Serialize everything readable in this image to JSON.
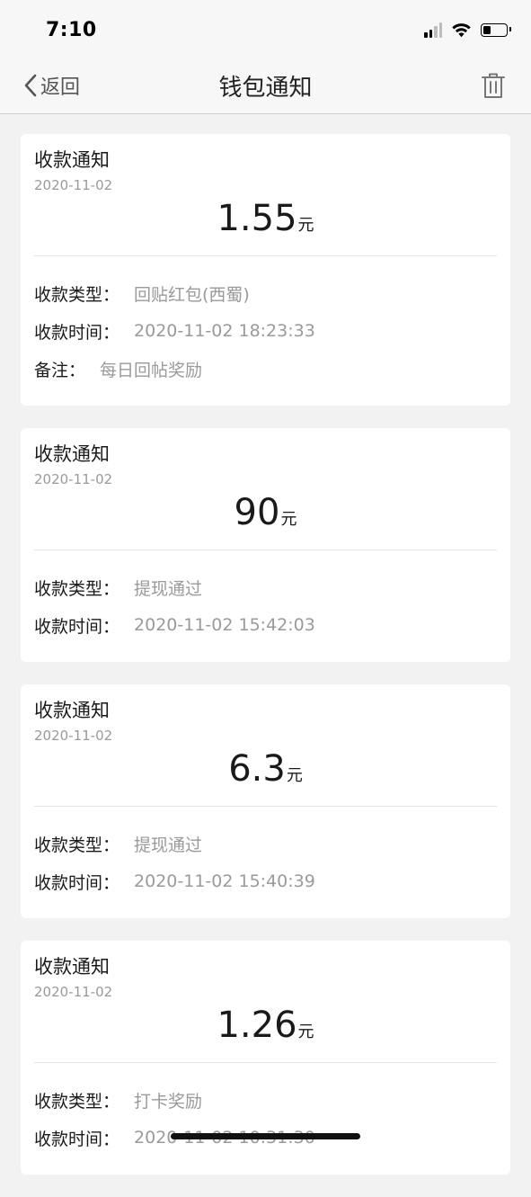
{
  "status_bar": {
    "time": "7:10"
  },
  "nav": {
    "back_label": "返回",
    "title": "钱包通知"
  },
  "notifications": [
    {
      "title": "收款通知",
      "date": "2020-11-02",
      "amount": "1.55",
      "unit": "元",
      "rows": [
        {
          "label": "收款类型：",
          "value": "回贴红包(西蜀)"
        },
        {
          "label": "收款时间：",
          "value": "2020-11-02 18:23:33"
        },
        {
          "label": "备注：",
          "value": "每日回帖奖励"
        }
      ]
    },
    {
      "title": "收款通知",
      "date": "2020-11-02",
      "amount": "90",
      "unit": "元",
      "rows": [
        {
          "label": "收款类型：",
          "value": "提现通过"
        },
        {
          "label": "收款时间：",
          "value": "2020-11-02 15:42:03"
        }
      ]
    },
    {
      "title": "收款通知",
      "date": "2020-11-02",
      "amount": "6.3",
      "unit": "元",
      "rows": [
        {
          "label": "收款类型：",
          "value": "提现通过"
        },
        {
          "label": "收款时间：",
          "value": "2020-11-02 15:40:39"
        }
      ]
    },
    {
      "title": "收款通知",
      "date": "2020-11-02",
      "amount": "1.26",
      "unit": "元",
      "rows": [
        {
          "label": "收款类型：",
          "value": "打卡奖励"
        },
        {
          "label": "收款时间：",
          "value": "2020-11-02 10:31:30"
        }
      ]
    }
  ],
  "icons": {
    "back": "chevron-left-icon",
    "delete": "trash-icon",
    "signal": "signal-icon",
    "wifi": "wifi-icon",
    "battery": "battery-icon"
  },
  "colors": {
    "background": "#f2f2f2",
    "card": "#ffffff",
    "muted_text": "#9a9a9a",
    "primary_text": "#1a1a1a"
  },
  "battery_level": 0.35
}
